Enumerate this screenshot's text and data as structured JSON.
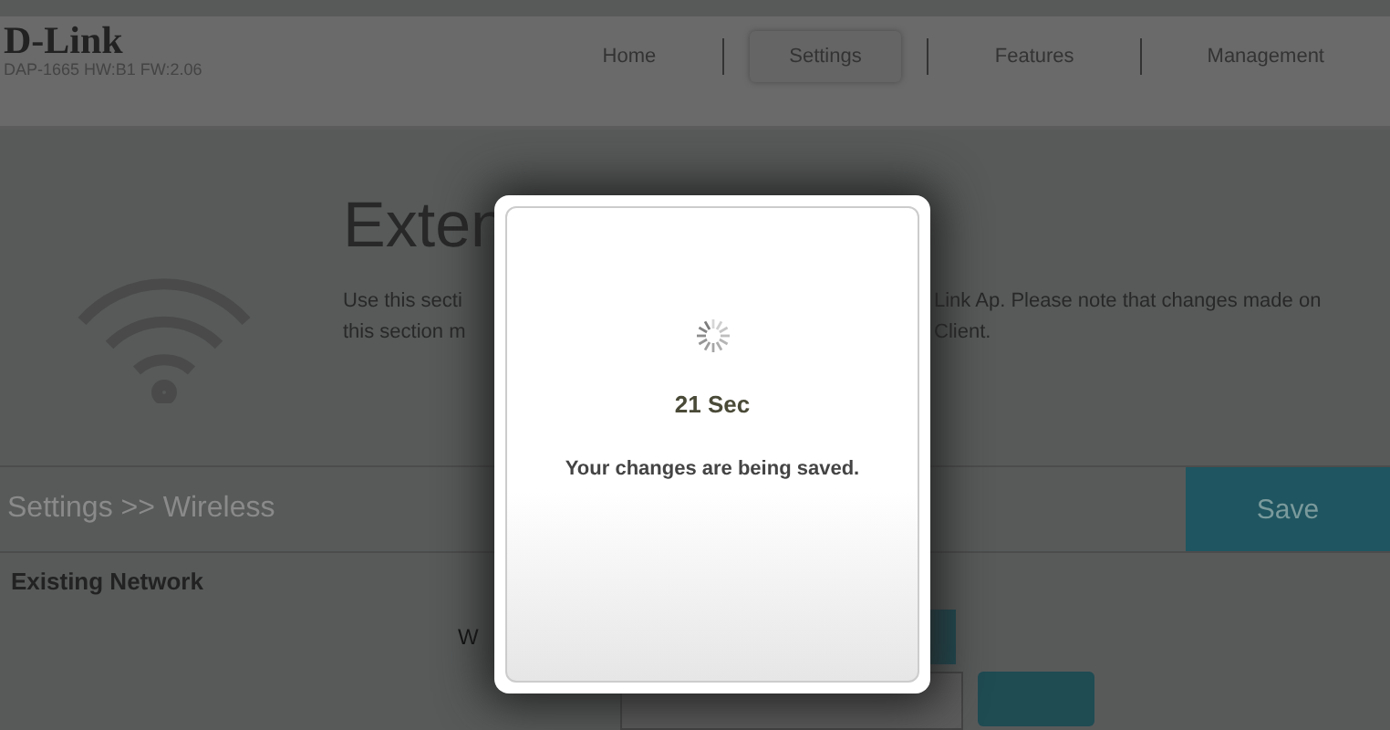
{
  "brand": {
    "logo": "D-Link",
    "model": "DAP-1665 HW:B1 FW:2.06"
  },
  "nav": [
    {
      "label": "Home",
      "selected": false
    },
    {
      "label": "Settings",
      "selected": true
    },
    {
      "label": "Features",
      "selected": false
    },
    {
      "label": "Management",
      "selected": false
    }
  ],
  "hero": {
    "title": "Exten",
    "description_left": [
      "Use this secti",
      "this section m"
    ],
    "description_right": [
      "Link Ap. Please note that changes made on",
      "Client."
    ]
  },
  "breadcrumb": "Settings >> Wireless",
  "save_button": "Save",
  "section": {
    "title": "Existing Network",
    "field_label": "W"
  },
  "modal": {
    "countdown": "21 Sec",
    "message": "Your changes are being saved."
  }
}
